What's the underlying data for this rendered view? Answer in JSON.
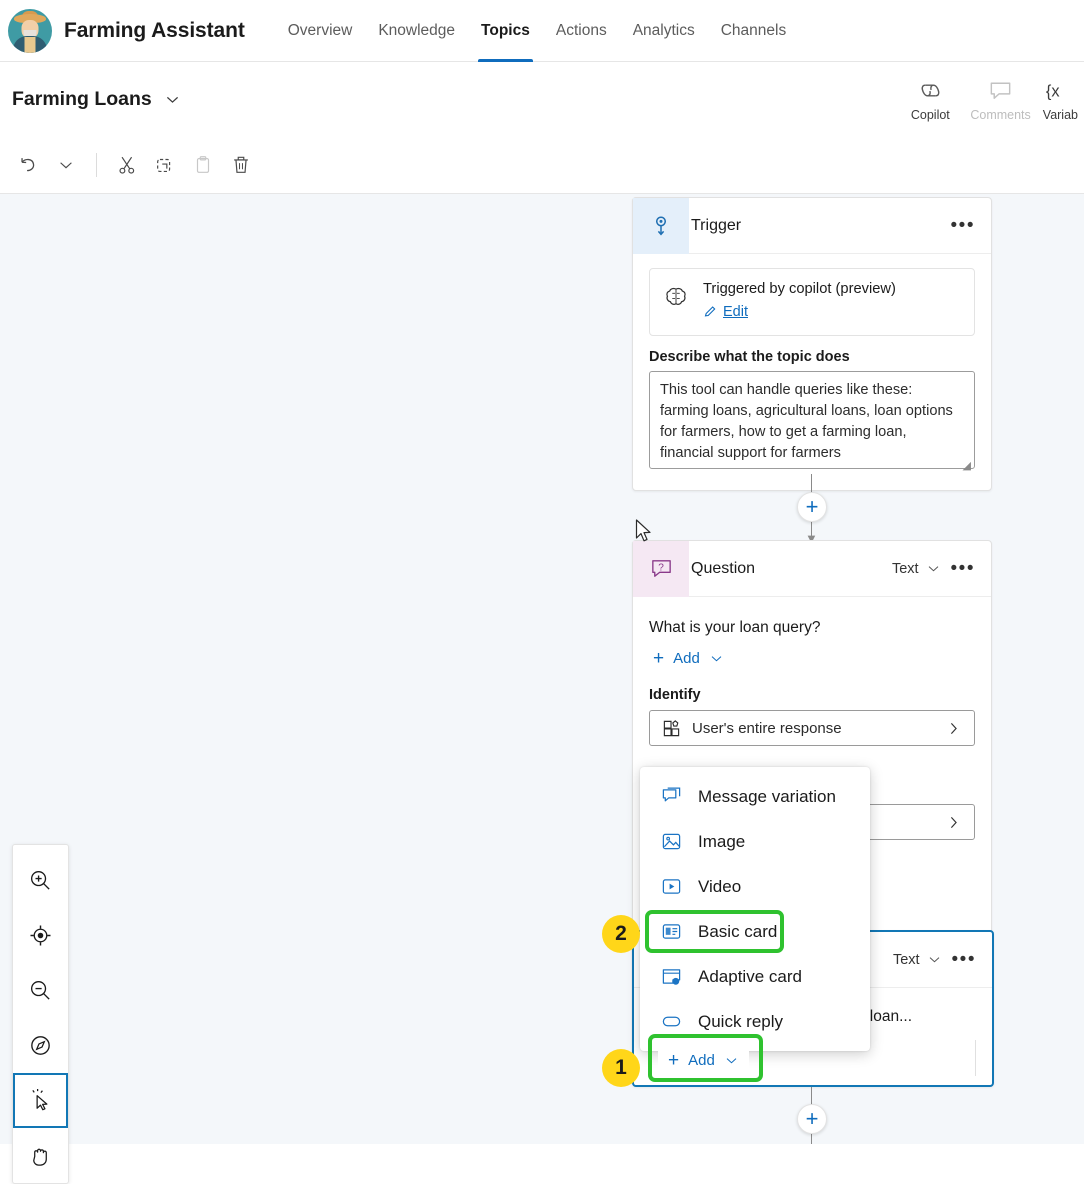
{
  "header": {
    "app_title": "Farming Assistant",
    "avatar_icon": "farmer-avatar",
    "tabs": [
      {
        "label": "Overview",
        "active": false
      },
      {
        "label": "Knowledge",
        "active": false
      },
      {
        "label": "Topics",
        "active": true
      },
      {
        "label": "Actions",
        "active": false
      },
      {
        "label": "Analytics",
        "active": false
      },
      {
        "label": "Channels",
        "active": false
      }
    ],
    "accent_color": "#0f6cbd"
  },
  "subheader": {
    "topic_title": "Farming Loans",
    "chevron_icon": "chevron-down-icon",
    "commands": [
      {
        "label": "Copilot",
        "icon": "copilot-icon",
        "disabled": false
      },
      {
        "label": "Comments",
        "icon": "comment-icon",
        "disabled": true
      },
      {
        "label": "Variab",
        "icon": "variables-icon",
        "disabled": false
      }
    ]
  },
  "edit_toolbar": {
    "buttons": [
      {
        "name": "undo",
        "icon": "undo-icon",
        "disabled": false
      },
      {
        "name": "undo-menu",
        "icon": "chevron-down-icon",
        "disabled": false
      },
      {
        "name": "cut",
        "icon": "scissors-icon",
        "disabled": false
      },
      {
        "name": "copy",
        "icon": "copy-icon",
        "disabled": false
      },
      {
        "name": "paste",
        "icon": "clipboard-icon",
        "disabled": true
      },
      {
        "name": "delete",
        "icon": "trash-icon",
        "disabled": false
      }
    ]
  },
  "canvas": {
    "background_color": "#f4f7fa",
    "trigger_node": {
      "title": "Trigger",
      "icon": "trigger-icon",
      "overflow_icon": "more-options-icon",
      "card_text": "Triggered by copilot (preview)",
      "card_icon": "brain-icon",
      "edit_label": "Edit",
      "edit_icon": "pencil-icon",
      "description_label": "Describe what the topic does",
      "description_value": "This tool can handle queries like these: farming loans, agricultural loans, loan options for farmers, how to get a farming loan, financial support for farmers"
    },
    "question_node": {
      "title": "Question",
      "icon": "question-icon",
      "type_label": "Text",
      "type_chevron_icon": "chevron-down-icon",
      "overflow_icon": "more-options-icon",
      "prompt_text": "What is your loan query?",
      "add_label": "Add",
      "add_plus_icon": "plus-icon",
      "add_chevron_icon": "chevron-down-icon",
      "identify_label": "Identify",
      "identify_value": "User's entire response",
      "identify_icon": "entity-icon",
      "identify_chevron_icon": "chevron-right-icon",
      "save_chevron_icon": "chevron-right-icon"
    },
    "message_node": {
      "type_label": "Text",
      "type_chevron_icon": "chevron-down-icon",
      "overflow_icon": "more-options-icon",
      "body_text_partial": "ur loan...",
      "add_label": "Add",
      "add_plus_icon": "plus-icon",
      "add_chevron_icon": "chevron-down-icon",
      "selected": true
    },
    "connector_plus_icon": "plus-icon"
  },
  "context_menu": {
    "items": [
      {
        "label": "Message variation",
        "icon": "message-variation-icon"
      },
      {
        "label": "Image",
        "icon": "image-icon"
      },
      {
        "label": "Video",
        "icon": "video-icon"
      },
      {
        "label": "Basic card",
        "icon": "basic-card-icon"
      },
      {
        "label": "Adaptive card",
        "icon": "adaptive-card-icon"
      },
      {
        "label": "Quick reply",
        "icon": "quick-reply-icon"
      }
    ]
  },
  "annotations": {
    "highlight_color": "#2fc22f",
    "badge_color": "#ffd619",
    "steps": [
      {
        "number": "1",
        "target": "add-button"
      },
      {
        "number": "2",
        "target": "basic-card-menu-item"
      }
    ]
  },
  "zoom_toolbar": {
    "buttons": [
      {
        "name": "zoom-in",
        "icon": "zoom-in-icon",
        "selected": false
      },
      {
        "name": "fit-to-screen",
        "icon": "fit-to-screen-icon",
        "selected": false
      },
      {
        "name": "zoom-out",
        "icon": "zoom-out-icon",
        "selected": false
      },
      {
        "name": "minimap",
        "icon": "minimap-icon",
        "selected": false
      },
      {
        "name": "select-tool",
        "icon": "cursor-select-icon",
        "selected": true
      },
      {
        "name": "pan-tool",
        "icon": "hand-icon",
        "selected": false
      }
    ]
  }
}
